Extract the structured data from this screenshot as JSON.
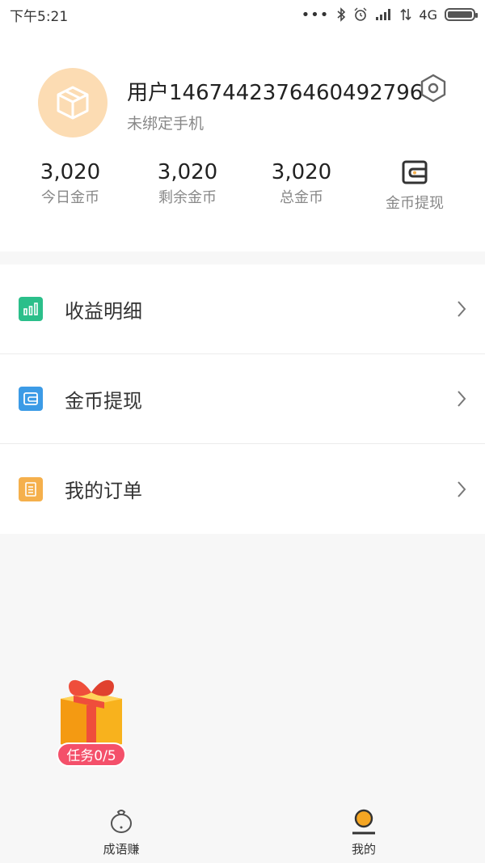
{
  "status_bar": {
    "time": "下午5:21",
    "network": "4G",
    "dots": "•••"
  },
  "profile": {
    "username": "用户1467442376460492796",
    "phone_status": "未绑定手机"
  },
  "stats": [
    {
      "value": "3,020",
      "label": "今日金币"
    },
    {
      "value": "3,020",
      "label": "剩余金币"
    },
    {
      "value": "3,020",
      "label": "总金币"
    },
    {
      "label": "金币提现"
    }
  ],
  "menu": [
    {
      "label": "收益明细",
      "icon": "bar-chart-icon",
      "color": "#2bbf8a"
    },
    {
      "label": "金币提现",
      "icon": "wallet-icon",
      "color": "#3c9be6"
    },
    {
      "label": "我的订单",
      "icon": "document-icon",
      "color": "#f5b04c"
    }
  ],
  "task_badge": {
    "label": "任务0/5"
  },
  "tabbar": {
    "left_label": "成语赚",
    "right_label": "我的"
  },
  "colors": {
    "avatar_bg": "#fcdcb3",
    "badge_bg": "#f4506a"
  }
}
